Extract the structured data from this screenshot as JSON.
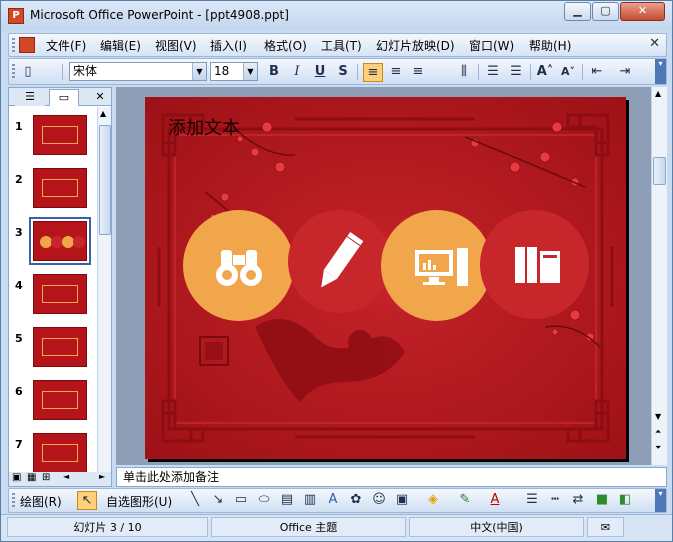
{
  "window": {
    "title": "Microsoft Office PowerPoint - [ppt4908.ppt]",
    "app_icon": "powerpoint-icon",
    "controls": [
      "minimize-icon",
      "maximize-icon",
      "close-icon"
    ]
  },
  "menu": {
    "items": [
      "文件(F)",
      "编辑(E)",
      "视图(V)",
      "插入(I)",
      "格式(O)",
      "工具(T)",
      "幻灯片放映(D)",
      "窗口(W)",
      "帮助(H)"
    ],
    "close_glyph": "✕"
  },
  "format_toolbar": {
    "font_name": "宋体",
    "font_size": "18",
    "bold": "B",
    "italic": "I",
    "underline": "U",
    "shadow": "S",
    "align_left_active": true
  },
  "slides_panel": {
    "tab_close": "✕",
    "slide_numbers": [
      "1",
      "2",
      "3",
      "4",
      "5",
      "6",
      "7"
    ],
    "selected_index": 3
  },
  "slide": {
    "placeholder_text": "添加文本",
    "icons": [
      "binoculars-icon",
      "pencil-icon",
      "computer-icon",
      "books-icon"
    ],
    "colors": {
      "background": "#b31a1f",
      "circle_orange": "#f2a64c",
      "circle_red": "#c7262a"
    }
  },
  "notes": {
    "placeholder": "单击此处添加备注"
  },
  "drawing_toolbar": {
    "draw_label": "绘图(R)",
    "autoshapes_label": "自选图形(U)"
  },
  "status": {
    "slide_position": "幻灯片 3 / 10",
    "theme": "Office 主题",
    "language": "中文(中国)"
  }
}
